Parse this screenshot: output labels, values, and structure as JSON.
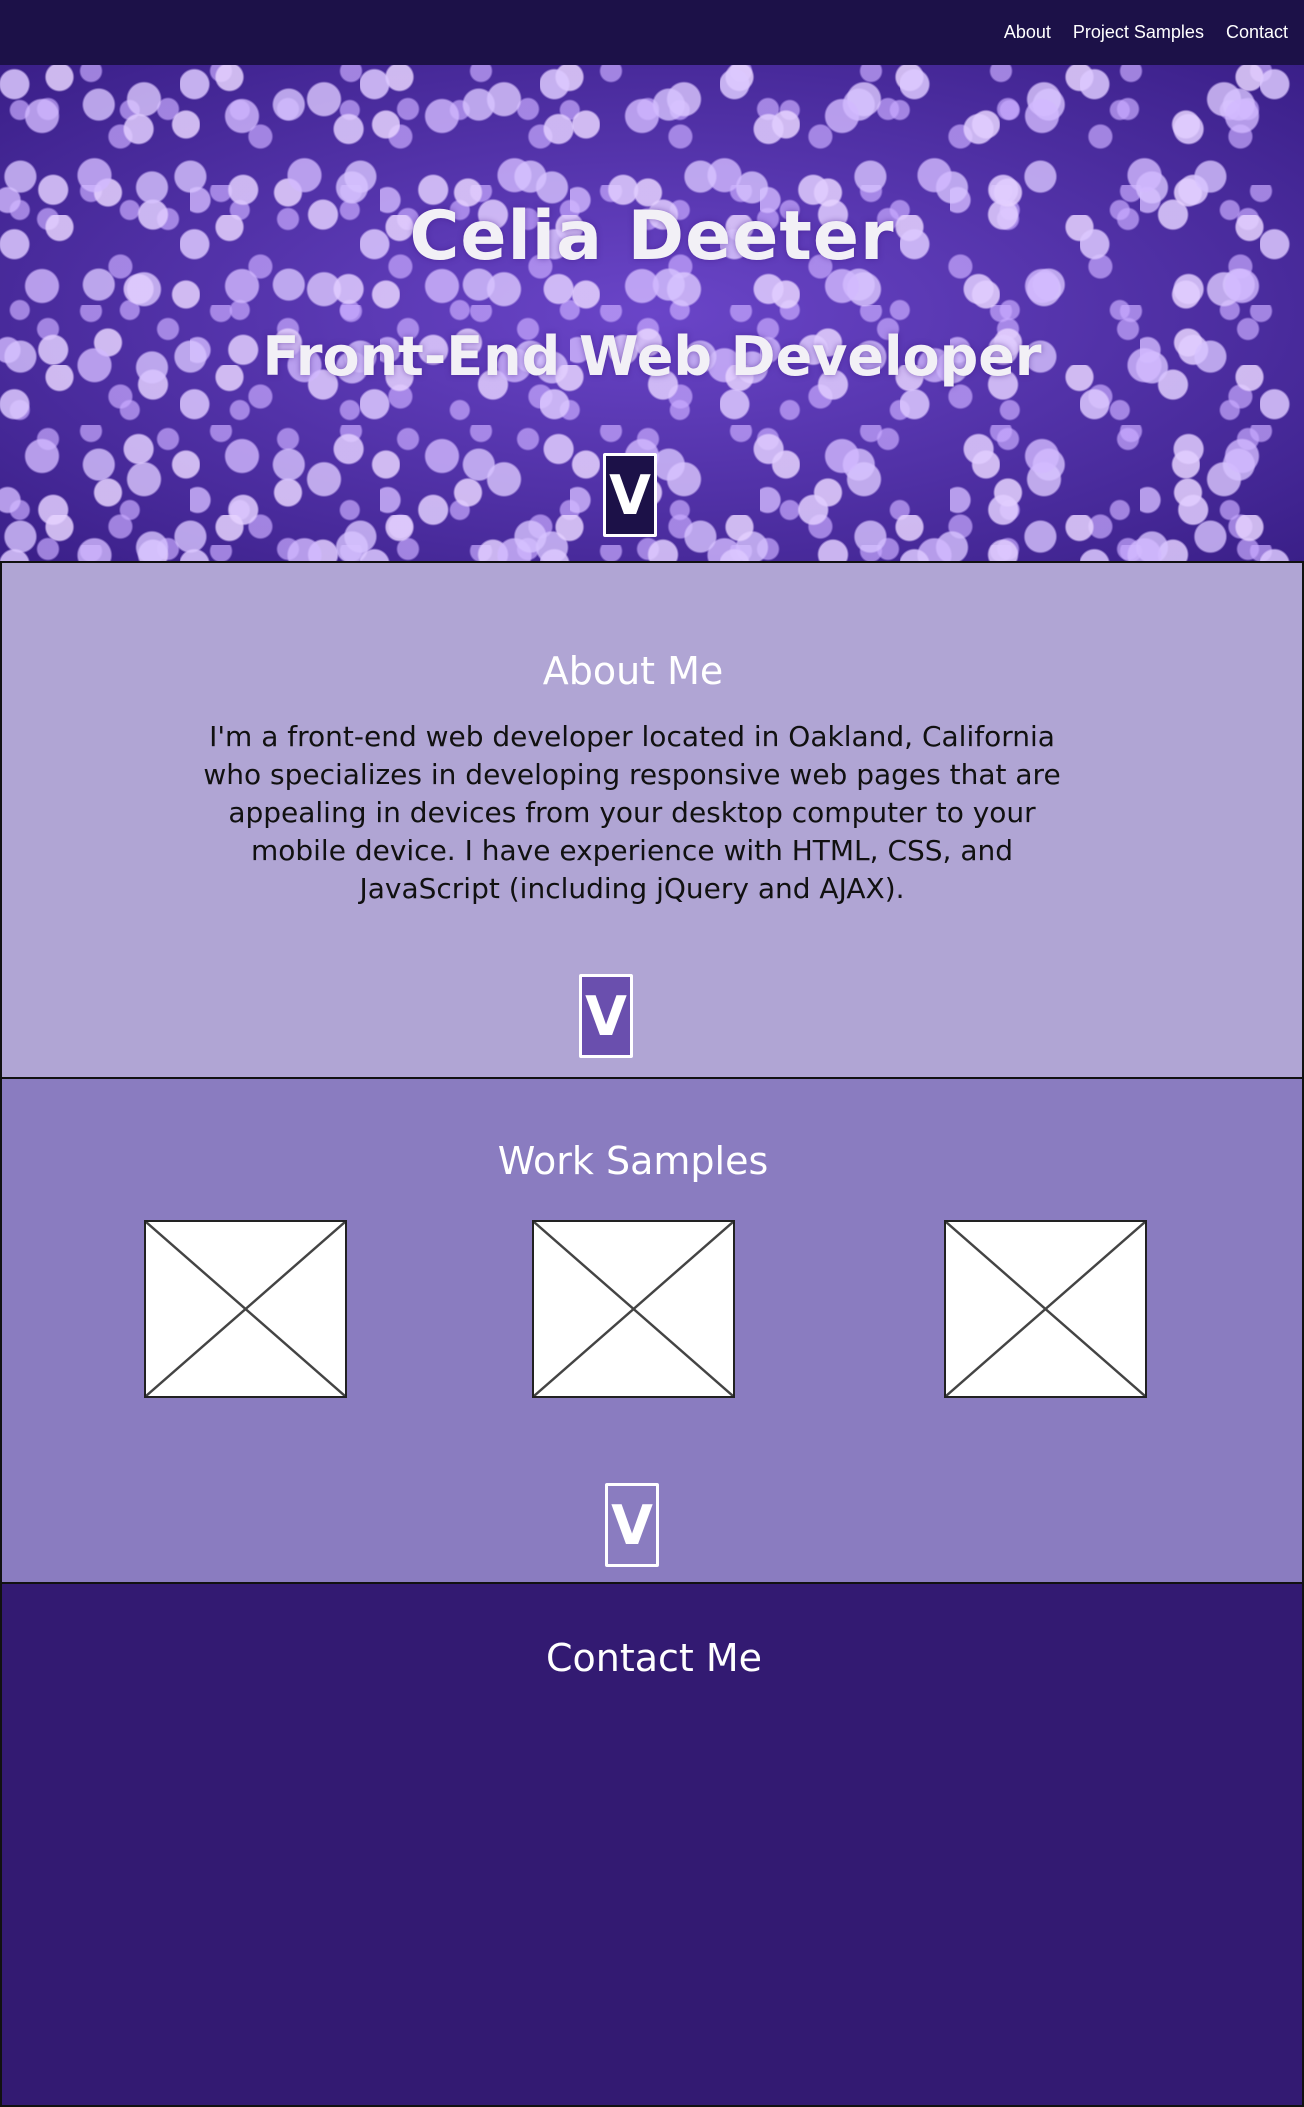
{
  "nav": {
    "links": [
      "About",
      "Project Samples",
      "Contact"
    ]
  },
  "hero": {
    "title": "Celia Deeter",
    "subtitle": "Front-End Web Developer",
    "scroll_icon": "chevron-down-icon",
    "scroll_label": "V"
  },
  "about": {
    "heading": "About Me",
    "text": "I'm a front-end web developer located in Oakland, California who specializes in developing responsive web pages that are appealing in devices from your desktop computer to your mobile device. I have experience with HTML, CSS, and JavaScript (including jQuery and AJAX).",
    "scroll_label": "V"
  },
  "work": {
    "heading": "Work Samples",
    "samples": [
      "image-placeholder",
      "image-placeholder",
      "image-placeholder"
    ],
    "scroll_label": "V"
  },
  "contact": {
    "heading": "Contact Me"
  },
  "colors": {
    "navbar": "#1c1148",
    "hero": "#5a35b0",
    "about_bg": "#b0a5d4",
    "work_bg": "#8a7cc0",
    "contact_bg": "#331a72"
  }
}
